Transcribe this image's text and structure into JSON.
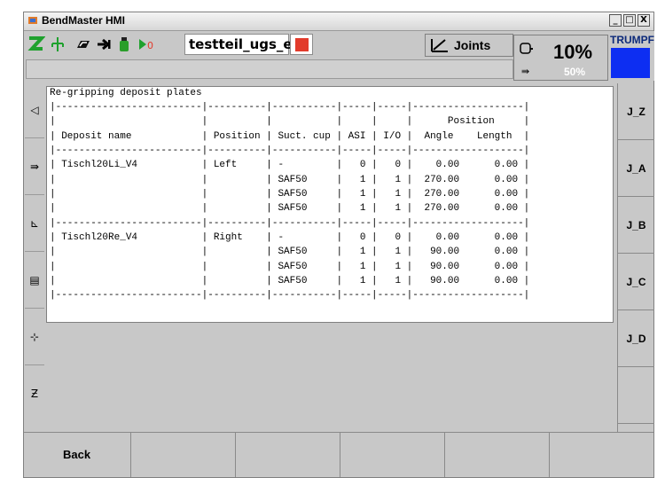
{
  "window": {
    "title": "BendMaster HMI",
    "controls": [
      "_",
      "□",
      "X"
    ]
  },
  "toolbar": {
    "program_name": "testteil_ugs_en",
    "joints_label": "Joints",
    "icons": [
      "axis-z-icon",
      "robot-axis-icon",
      "gripper-icon",
      "arrow-right-icon",
      "bottle-icon",
      "power-off-icon"
    ]
  },
  "speed": {
    "value": "10%",
    "sub_value": "50%"
  },
  "brand": {
    "name": "TRUMPF",
    "color": "#0d2ef2"
  },
  "left_buttons": [
    "triangle-left-icon",
    "arrow-into-icon",
    "axes-icon",
    "panel-icon",
    "crosshair-icon",
    "z-axis-icon"
  ],
  "content": {
    "heading": "Re-gripping deposit plates",
    "table_lines": [
      "|-------------------------|----------|-----------|-----|-----|-------------------|",
      "|                         |          |           |     |     |      Position     |",
      "| Deposit name            | Position | Suct. cup | ASI | I/O |  Angle    Length  |",
      "|-------------------------|----------|-----------|-----|-----|-------------------|",
      "| Tischl20Li_V4           | Left     | -         |   0 |   0 |    0.00      0.00 |",
      "|                         |          | SAF50     |   1 |   1 |  270.00      0.00 |",
      "|                         |          | SAF50     |   1 |   1 |  270.00      0.00 |",
      "|                         |          | SAF50     |   1 |   1 |  270.00      0.00 |",
      "|-------------------------|----------|-----------|-----|-----|-------------------|",
      "| Tischl20Re_V4           | Right    | -         |   0 |   0 |    0.00      0.00 |",
      "|                         |          | SAF50     |   1 |   1 |   90.00      0.00 |",
      "|                         |          | SAF50     |   1 |   1 |   90.00      0.00 |",
      "|                         |          | SAF50     |   1 |   1 |   90.00      0.00 |",
      "|-------------------------|----------|-----------|-----|-----|-------------------|"
    ]
  },
  "right_buttons": [
    "J_Z",
    "J_A",
    "J_B",
    "J_C",
    "J_D",
    "",
    ""
  ],
  "bottom_buttons": [
    "Back",
    "",
    "",
    "",
    "",
    ""
  ]
}
